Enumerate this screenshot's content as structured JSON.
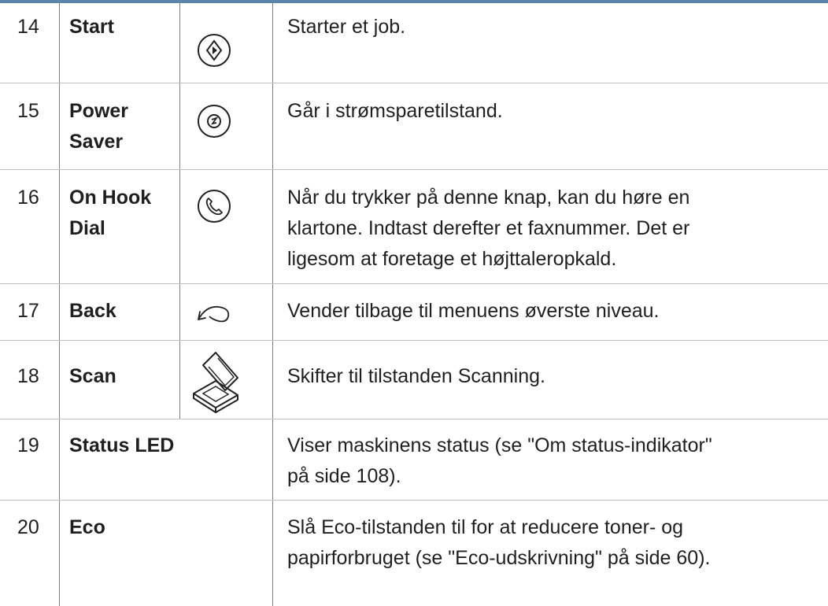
{
  "rows": [
    {
      "number": "14",
      "name": "Start",
      "icon": "start-icon",
      "description": "Starter et job."
    },
    {
      "number": "15",
      "name_lines": [
        "Power",
        "Saver"
      ],
      "icon": "power-saver-icon",
      "description": "Går i strømsparetilstand."
    },
    {
      "number": "16",
      "name_lines": [
        "On Hook",
        "Dial"
      ],
      "icon": "on-hook-dial-icon",
      "description_lines": [
        "Når du trykker på denne knap, kan du høre en",
        "klartone. Indtast derefter et faxnummer. Det er",
        "ligesom at foretage et højttaleropkald."
      ]
    },
    {
      "number": "17",
      "name": "Back",
      "icon": "back-icon",
      "description": "Vender tilbage til menuens øverste niveau."
    },
    {
      "number": "18",
      "name": "Scan",
      "icon": "scan-icon",
      "description": "Skifter til tilstanden Scanning."
    },
    {
      "number": "19",
      "name": "Status LED",
      "description_lines": [
        "Viser maskinens status (se \"Om status-indikator\"",
        "på side 108)."
      ]
    },
    {
      "number": "20",
      "name": "Eco",
      "description_lines": [
        "Slå Eco-tilstanden til for at reducere toner- og",
        "papirforbruget (se \"Eco-udskrivning\" på side 60)."
      ]
    }
  ]
}
